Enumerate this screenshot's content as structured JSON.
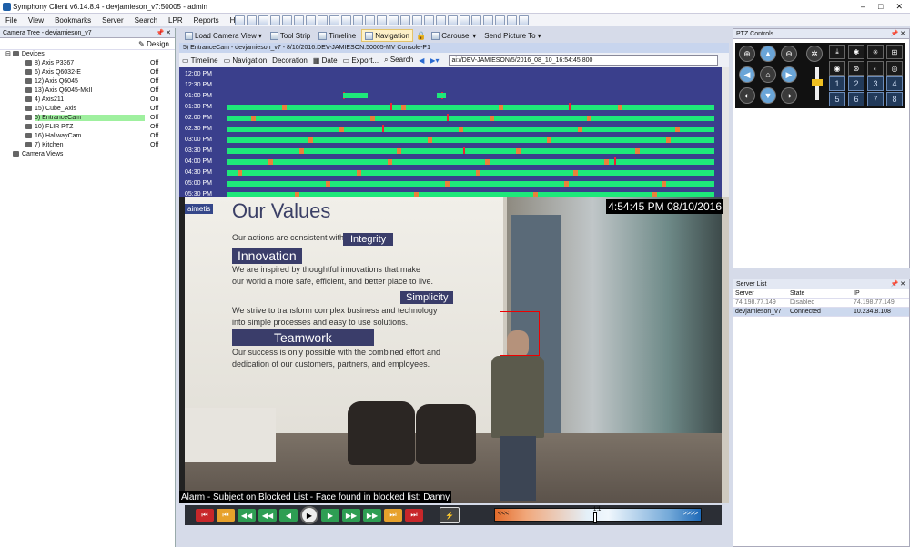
{
  "window": {
    "title": "Symphony Client v6.14.8.4 - devjamieson_v7:50005 - admin",
    "controls": [
      "–",
      "□",
      "✕"
    ]
  },
  "menu": [
    "File",
    "View",
    "Bookmarks",
    "Server",
    "Search",
    "LPR",
    "Reports",
    "Help"
  ],
  "camera_tree": {
    "header": "Camera Tree - devjamieson_v7",
    "design_label": "Design",
    "devices_label": "Devices",
    "cameras": [
      {
        "name": "8) Axis P3367",
        "status": "Off"
      },
      {
        "name": "6) Axis Q6032-E",
        "status": "Off"
      },
      {
        "name": "12) Axis Q6045",
        "status": "Off"
      },
      {
        "name": "13) Axis Q6045-MkII",
        "status": "Off"
      },
      {
        "name": "4) Axis211",
        "status": "On"
      },
      {
        "name": "15) Cube_Axis",
        "status": "Off"
      },
      {
        "name": "5) EntranceCam",
        "status": "Off",
        "selected": true
      },
      {
        "name": "10) FLIR PTZ",
        "status": "Off"
      },
      {
        "name": "16) HallwayCam",
        "status": "Off"
      },
      {
        "name": "7) Kitchen",
        "status": "Off"
      }
    ],
    "views_label": "Camera Views"
  },
  "center": {
    "tabs": [
      {
        "label": "Load Camera View",
        "dropdown": true
      },
      {
        "label": "Tool Strip"
      },
      {
        "label": "Timeline"
      },
      {
        "label": "Navigation",
        "active": true
      },
      {
        "label": "Carousel",
        "dropdown": true
      },
      {
        "label": "Send Picture To",
        "dropdown": true
      }
    ],
    "camera_title": "5) EntranceCam - devjamieson_v7 - 8/10/2016:DEV-JAMIESON:50005-MV Console-P1",
    "camera_tools": [
      "Timeline",
      "Navigation",
      "Decoration",
      "Date",
      "Export...",
      "Search"
    ],
    "address": "ai://DEV-JAMIESON/5/2016_08_10_16:54:45.800",
    "timeline_hours": [
      "12:00 PM",
      "12:30 PM",
      "01:00 PM",
      "01:30 PM",
      "02:00 PM",
      "02:30 PM",
      "03:00 PM",
      "03:30 PM",
      "04:00 PM",
      "04:30 PM",
      "05:00 PM",
      "05:30 PM",
      "06:30 PM"
    ]
  },
  "video": {
    "logo": "aimetis",
    "timestamp": "4:54:45 PM 08/10/2016",
    "alarm": "Alarm - Subject on Blocked List - Face found in blocked list: Danny",
    "wall_title": "Our Values",
    "wall_lines": [
      "Our actions are consistent with our values.",
      "We are inspired by thoughtful innovations that make",
      "our world a more safe, efficient, and better place to live.",
      "We strive to transform complex business and technology",
      "into simple processes and easy to use solutions.",
      "Our success is only possible with the combined effort and",
      "dedication of our customers, partners, and employees."
    ],
    "banners": [
      "Integrity",
      "Innovation",
      "Simplicity",
      "Teamwork"
    ]
  },
  "playback": {
    "speed_label": "1:1",
    "speed_left": "<<<",
    "speed_right": ">>>>"
  },
  "ptz": {
    "header": "PTZ Controls",
    "keypad": [
      "1",
      "2",
      "3",
      "4",
      "5",
      "6",
      "7",
      "8"
    ]
  },
  "server_list": {
    "header": "Server List",
    "columns": [
      "Server",
      "State",
      "IP"
    ],
    "rows": [
      {
        "server": "74.198.77.149",
        "state": "Disabled",
        "ip": "74.198.77.149"
      },
      {
        "server": "devjamieson_v7",
        "state": "Connected",
        "ip": "10.234.8.108",
        "selected": true
      }
    ]
  }
}
